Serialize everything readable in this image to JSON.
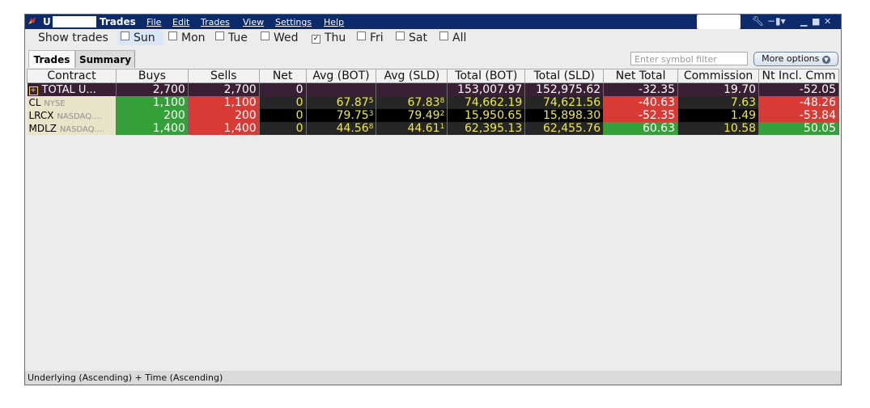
{
  "titlebar": {
    "account": "U",
    "app_title": "Trades",
    "menu": [
      "File",
      "Edit",
      "Trades",
      "View",
      "Settings",
      "Help"
    ],
    "tools_icons": [
      "wrench-icon",
      "pin-icon"
    ],
    "window_controls": [
      "minimize-icon",
      "maximize-icon",
      "close-icon"
    ]
  },
  "show_trades": {
    "label": "Show trades",
    "days": [
      {
        "label": "Sun",
        "checked": false,
        "highlighted": true
      },
      {
        "label": "Mon",
        "checked": false
      },
      {
        "label": "Tue",
        "checked": false
      },
      {
        "label": "Wed",
        "checked": false
      },
      {
        "label": "Thu",
        "checked": true
      },
      {
        "label": "Fri",
        "checked": false
      },
      {
        "label": "Sat",
        "checked": false
      },
      {
        "label": "All",
        "checked": false
      }
    ]
  },
  "tabs": [
    "Trades",
    "Summary"
  ],
  "filter": {
    "placeholder": "Enter symbol filter"
  },
  "more_options_label": "More options",
  "columns": [
    "Contract",
    "Buys",
    "Sells",
    "Net",
    "Avg (BOT)",
    "Avg (SLD)",
    "Total (BOT)",
    "Total (SLD)",
    "Net Total",
    "Commission",
    "Nt Incl. Cmm"
  ],
  "total_row": {
    "contract": "TOTAL U...",
    "buys": "2,700",
    "sells": "2,700",
    "net": "0",
    "avg_bot": "",
    "avg_sld": "",
    "total_bot": "153,007.97",
    "total_sld": "152,975.62",
    "net_total": "-32.35",
    "commission": "19.70",
    "nt_incl_cmm": "-52.05"
  },
  "rows": [
    {
      "symbol": "CL",
      "exchange": "NYSE",
      "buys": "1,100",
      "sells": "1,100",
      "net": "0",
      "avg_bot": "67.87",
      "avg_bot_sup": "5",
      "avg_sld": "67.83",
      "avg_sld_sup": "8",
      "total_bot": "74,662.19",
      "total_sld": "74,621.56",
      "net_total": "-40.63",
      "commission": "7.63",
      "nt_incl_cmm": "-48.26"
    },
    {
      "symbol": "LRCX",
      "exchange": "NASDAQ....",
      "buys": "200",
      "sells": "200",
      "net": "0",
      "avg_bot": "79.75",
      "avg_bot_sup": "3",
      "avg_sld": "79.49",
      "avg_sld_sup": "2",
      "total_bot": "15,950.65",
      "total_sld": "15,898.30",
      "net_total": "-52.35",
      "commission": "1.49",
      "nt_incl_cmm": "-53.84"
    },
    {
      "symbol": "MDLZ",
      "exchange": "NASDAQ....",
      "buys": "1,400",
      "sells": "1,400",
      "net": "0",
      "avg_bot": "44.56",
      "avg_bot_sup": "8",
      "avg_sld": "44.61",
      "avg_sld_sup": "1",
      "total_bot": "62,395.13",
      "total_sld": "62,455.76",
      "net_total": "60.63",
      "commission": "10.58",
      "nt_incl_cmm": "50.05"
    }
  ],
  "status_bar": "Underlying (Ascending) + Time (Ascending)",
  "colors": {
    "title_bg": "#0d2a6b",
    "green": "#35a03a",
    "red": "#d83b35",
    "yellow": "#f1ec3a",
    "total_bg": "#3a1f35"
  }
}
